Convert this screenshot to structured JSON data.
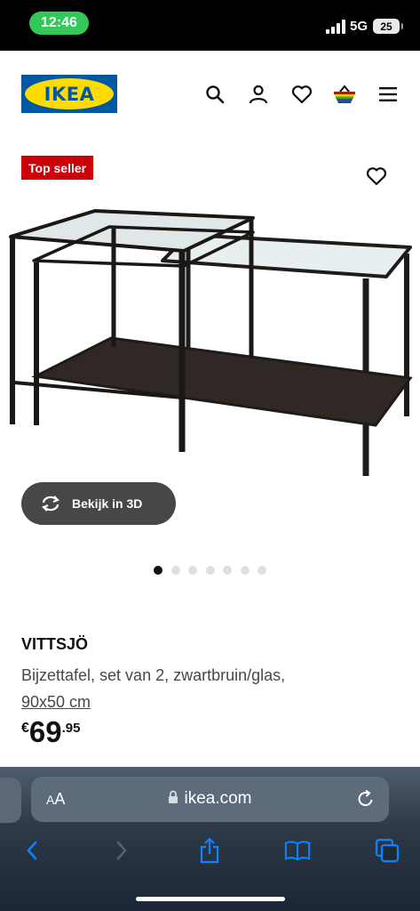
{
  "status_bar": {
    "time": "12:46",
    "network": "5G",
    "battery": "25",
    "time_pill_color": "#34c759"
  },
  "header": {
    "logo_text": "IKEA",
    "brand_blue": "#0058a3",
    "brand_yellow": "#ffdb00",
    "icons": [
      "search-icon",
      "account-icon",
      "heart-icon",
      "basket-icon",
      "menu-icon"
    ]
  },
  "product": {
    "badge": "Top seller",
    "badge_color": "#cc0008",
    "view_3d_label": "Bekijk in 3D",
    "carousel": {
      "total": 7,
      "active": 1
    },
    "name": "VITTSJÖ",
    "description": "Bijzettafel, set van 2, zwartbruin/glas,",
    "size": "90x50 cm",
    "price": {
      "currency": "€",
      "integer": "69",
      "decimal": ".95"
    }
  },
  "safari": {
    "text_size_small": "A",
    "text_size_large": "A",
    "domain": "ikea.com",
    "toolbar_icons": [
      "back-icon",
      "forward-icon",
      "share-icon",
      "bookmarks-icon",
      "tabs-icon"
    ],
    "accent": "#0a84ff"
  }
}
